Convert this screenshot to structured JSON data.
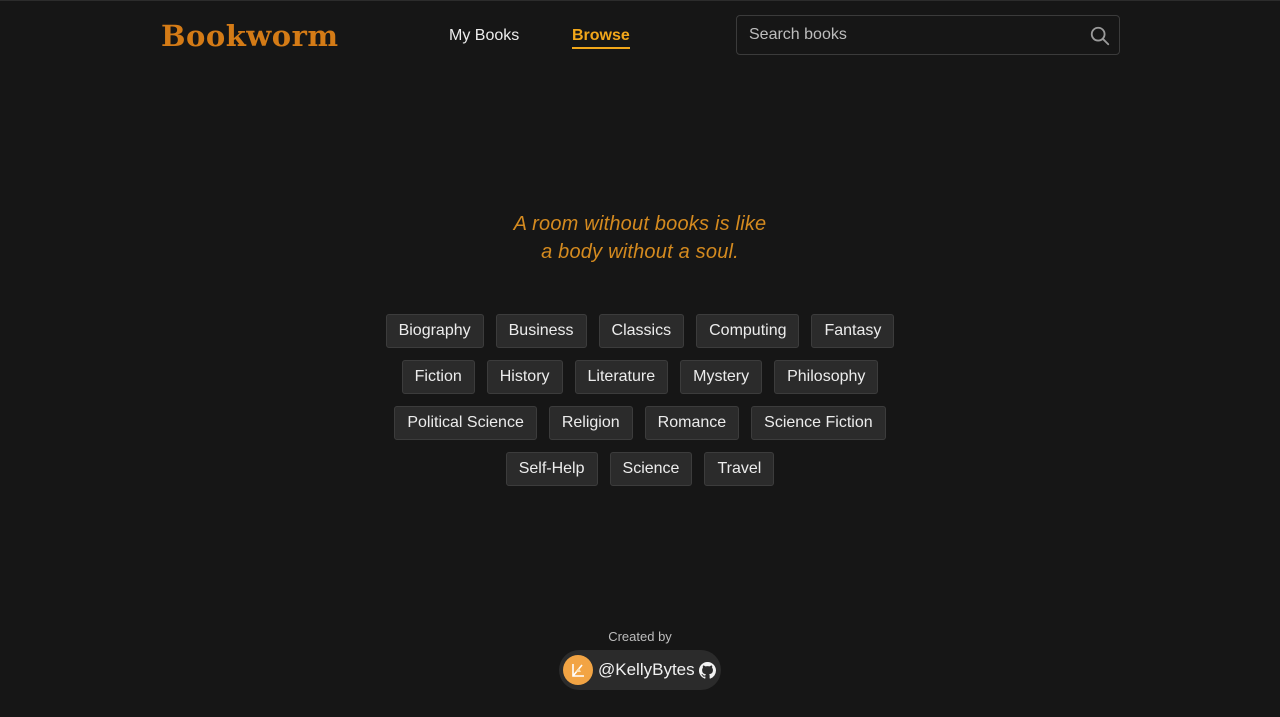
{
  "header": {
    "logo": "Bookworm",
    "nav": {
      "my_books": "My Books",
      "browse": "Browse"
    },
    "search": {
      "placeholder": "Search books",
      "value": "",
      "icon": "search-icon"
    }
  },
  "quote": {
    "line1": "A room without books is like",
    "line2": "a body without a soul."
  },
  "genres": [
    "Biography",
    "Business",
    "Classics",
    "Computing",
    "Fantasy",
    "Fiction",
    "History",
    "Literature",
    "Mystery",
    "Philosophy",
    "Political Science",
    "Religion",
    "Romance",
    "Science Fiction",
    "Self-Help",
    "Science",
    "Travel"
  ],
  "footer": {
    "created_by": "Created by",
    "author": "@KellyBytes",
    "icons": [
      "avatar",
      "github-icon"
    ]
  },
  "colors": {
    "background": "#161616",
    "accent": "#f2a71a",
    "logo": "#d47b16",
    "quote": "#d48a1f",
    "chip": "#2b2b2b"
  }
}
